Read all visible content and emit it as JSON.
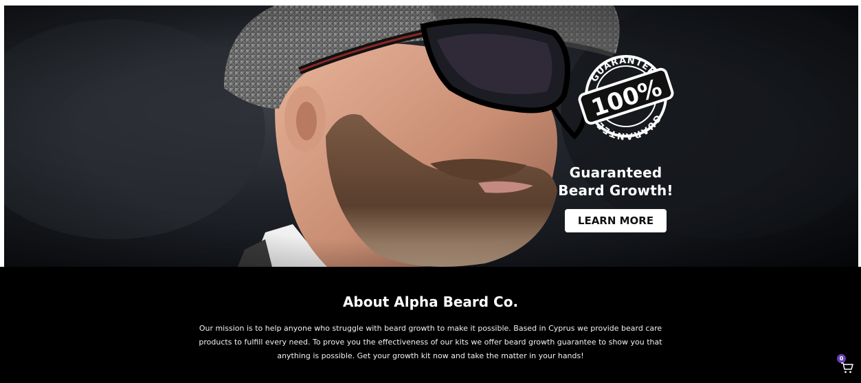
{
  "hero": {
    "title_line1": "Guaranteed",
    "title_line2": "Beard Growth!",
    "cta_label": "LEARN MORE",
    "image_alt": "bearded man in glasses and tweed flat cap"
  },
  "stamp": {
    "top_text": "GUARANTEED",
    "center_text": "100%",
    "bottom_text": "GUARANTEED"
  },
  "about": {
    "title": "About Alpha Beard Co.",
    "line1": "Our mission is to help anyone who struggle with beard growth to make it possible. Based in Cyprus we provide beard care",
    "line2": "products to fulfill every need. To prove you the effectiveness of our kits we offer beard growth guarantee to show you that",
    "line3": "anything is possible. Get your growth kit now and take the matter in your hands!"
  },
  "cart": {
    "count": "0",
    "icon": "cart-icon",
    "badge_color": "#6a3fb5"
  },
  "colors": {
    "about_bg": "#000000",
    "hero_text": "#ffffff",
    "button_bg": "#ffffff",
    "button_text": "#111111"
  }
}
